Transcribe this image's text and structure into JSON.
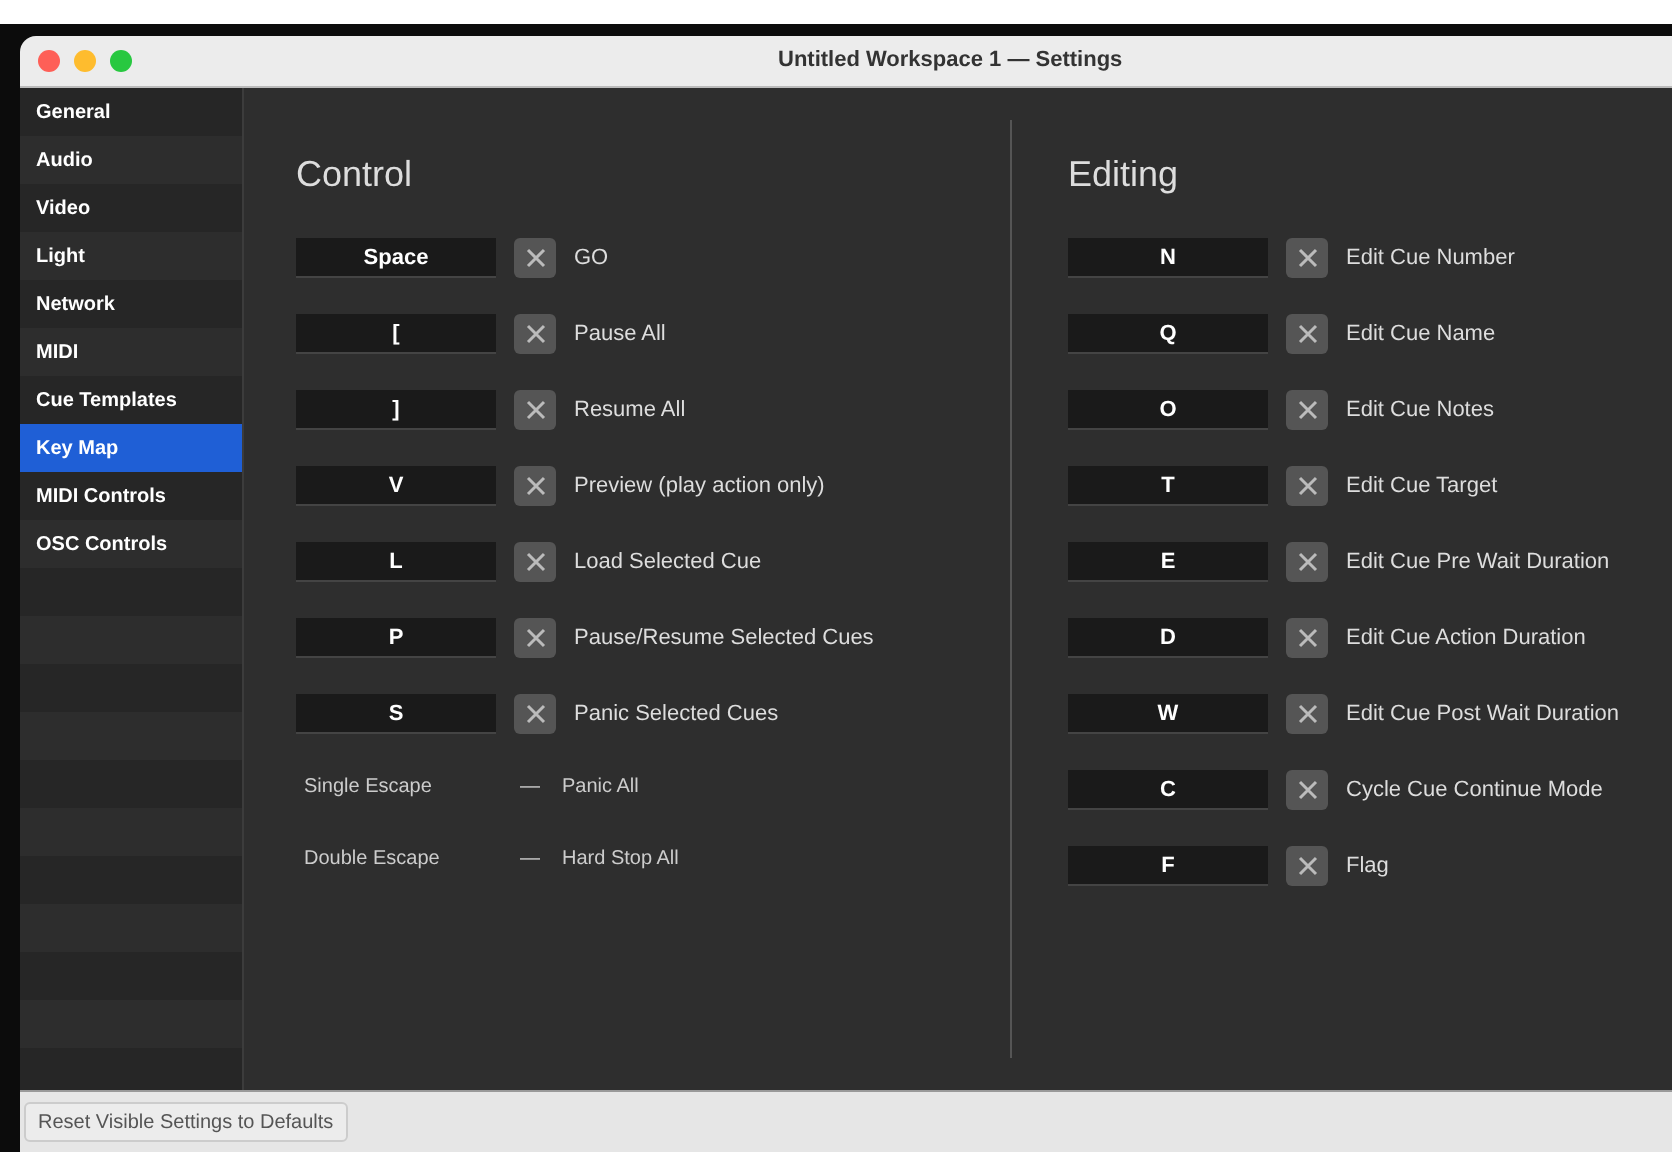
{
  "window": {
    "title": "Untitled Workspace 1 — Settings"
  },
  "sidebar": {
    "items": [
      {
        "label": "General",
        "selected": false
      },
      {
        "label": "Audio",
        "selected": false
      },
      {
        "label": "Video",
        "selected": false
      },
      {
        "label": "Light",
        "selected": false
      },
      {
        "label": "Network",
        "selected": false
      },
      {
        "label": "MIDI",
        "selected": false
      },
      {
        "label": "Cue Templates",
        "selected": false
      },
      {
        "label": "Key Map",
        "selected": true
      },
      {
        "label": "MIDI Controls",
        "selected": false
      },
      {
        "label": "OSC Controls",
        "selected": false
      }
    ]
  },
  "control": {
    "title": "Control",
    "bindings": [
      {
        "key": "Space",
        "action": "GO"
      },
      {
        "key": "[",
        "action": "Pause All"
      },
      {
        "key": "]",
        "action": "Resume All"
      },
      {
        "key": "V",
        "action": "Preview (play action only)"
      },
      {
        "key": "L",
        "action": "Load Selected Cue"
      },
      {
        "key": "P",
        "action": "Pause/Resume Selected Cues"
      },
      {
        "key": "S",
        "action": "Panic Selected Cues"
      }
    ],
    "fixed": [
      {
        "key": "Single Escape",
        "dash": "—",
        "action": "Panic All"
      },
      {
        "key": "Double Escape",
        "dash": "—",
        "action": "Hard Stop All"
      }
    ]
  },
  "editing": {
    "title": "Editing",
    "bindings": [
      {
        "key": "N",
        "action": "Edit Cue Number"
      },
      {
        "key": "Q",
        "action": "Edit Cue Name"
      },
      {
        "key": "O",
        "action": "Edit Cue Notes"
      },
      {
        "key": "T",
        "action": "Edit Cue Target"
      },
      {
        "key": "E",
        "action": "Edit Cue Pre Wait Duration"
      },
      {
        "key": "D",
        "action": "Edit Cue Action Duration"
      },
      {
        "key": "W",
        "action": "Edit Cue Post Wait Duration"
      },
      {
        "key": "C",
        "action": "Cycle Cue Continue Mode"
      },
      {
        "key": "F",
        "action": "Flag"
      }
    ]
  },
  "footer": {
    "button": "Reset Visible Settings to Defaults"
  }
}
